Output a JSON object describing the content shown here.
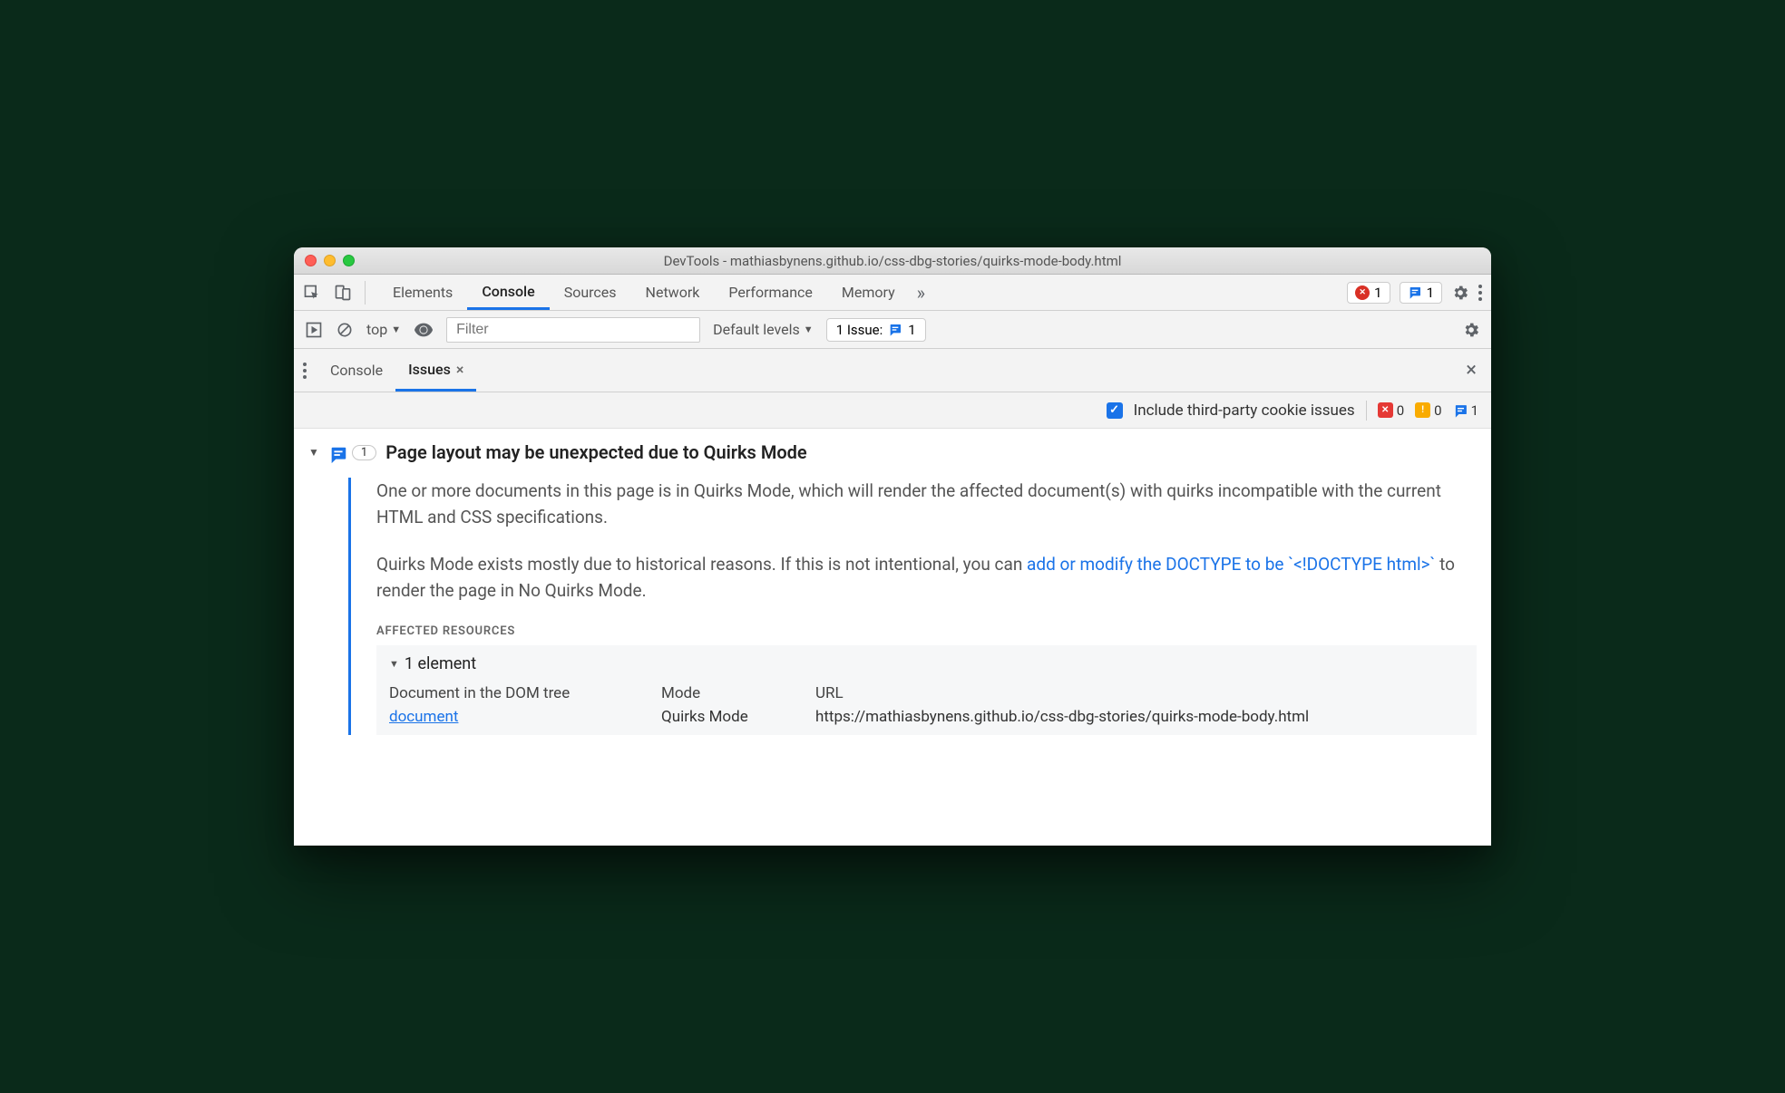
{
  "window": {
    "title": "DevTools - mathiasbynens.github.io/css-dbg-stories/quirks-mode-body.html"
  },
  "mainTabs": [
    "Elements",
    "Console",
    "Sources",
    "Network",
    "Performance",
    "Memory"
  ],
  "mainActive": "Console",
  "topBadges": {
    "error_count": "1",
    "issue_count": "1"
  },
  "consoleToolbar": {
    "context": "top",
    "filter_placeholder": "Filter",
    "levels_label": "Default levels",
    "issues_label": "1 Issue:",
    "issues_count": "1"
  },
  "drawerTabs": {
    "console": "Console",
    "issues": "Issues"
  },
  "issuesToolbar": {
    "thirdparty_label": "Include third-party cookie issues",
    "err_count": "0",
    "warn_count": "0",
    "info_count": "1"
  },
  "issue": {
    "count": "1",
    "title": "Page layout may be unexpected due to Quirks Mode",
    "p1": "One or more documents in this page is in Quirks Mode, which will render the affected document(s) with quirks incompatible with the current HTML and CSS specifications.",
    "p2a": "Quirks Mode exists mostly due to historical reasons. If this is not intentional, you can ",
    "p2link": "add or modify the DOCTYPE to be `<!DOCTYPE html>`",
    "p2b": " to render the page in No Quirks Mode.",
    "section": "AFFECTED RESOURCES",
    "element_head": "1 element",
    "columns": {
      "c1": "Document in the DOM tree",
      "c2": "Mode",
      "c3": "URL"
    },
    "row": {
      "c1": "document",
      "c2": "Quirks Mode",
      "c3": "https://mathiasbynens.github.io/css-dbg-stories/quirks-mode-body.html"
    }
  }
}
